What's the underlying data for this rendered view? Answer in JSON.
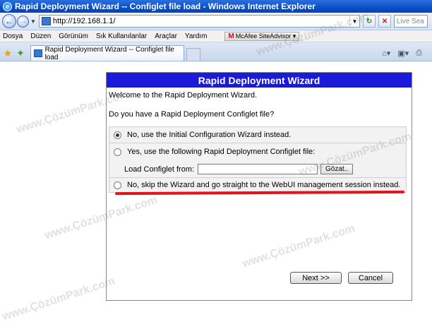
{
  "window": {
    "title": "Rapid Deployment Wizard -- Configlet file load - Windows Internet Explorer"
  },
  "address": {
    "url": "http://192.168.1.1/",
    "live_search_placeholder": "Live Sea"
  },
  "menu": {
    "items": [
      "Dosya",
      "Düzen",
      "Görünüm",
      "Sık Kullanılanlar",
      "Araçlar",
      "Yardım"
    ],
    "mcafee_logo": "M",
    "mcafee_label": "McAfee SiteAdvisor"
  },
  "tabs": [
    {
      "label": "Rapid Deployment Wizard -- Configlet file load"
    }
  ],
  "wizard": {
    "title": "Rapid Deployment Wizard",
    "welcome": "Welcome to the Rapid Deployment Wizard.",
    "question": "Do you have a Rapid Deployment Configlet file?",
    "options": [
      {
        "label": "No, use the Initial Configuration Wizard instead.",
        "selected": true
      },
      {
        "label": "Yes, use the following Rapid Deployment Configlet file:",
        "selected": false
      },
      {
        "label": "No, skip the Wizard and go straight to the WebUI management session instead.",
        "selected": false
      }
    ],
    "load_label": "Load Configlet from:",
    "browse_label": "Gözat..",
    "next_label": "Next >>",
    "cancel_label": "Cancel"
  },
  "watermark": "www.ÇözümPark.com"
}
